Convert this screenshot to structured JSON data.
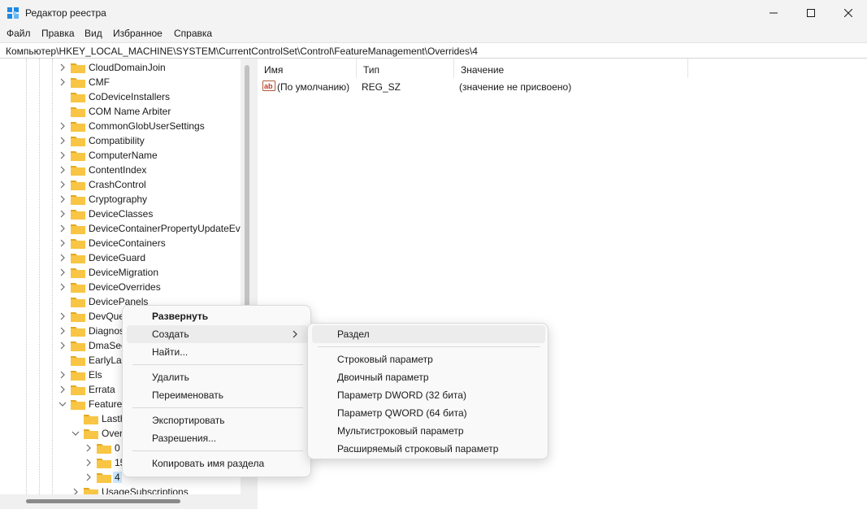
{
  "window": {
    "title": "Редактор реестра",
    "icon": "regedit-icon"
  },
  "menubar": {
    "items": [
      "Файл",
      "Правка",
      "Вид",
      "Избранное",
      "Справка"
    ]
  },
  "address": {
    "path": "Компьютер\\HKEY_LOCAL_MACHINE\\SYSTEM\\CurrentControlSet\\Control\\FeatureManagement\\Overrides\\4"
  },
  "tree": {
    "items": [
      {
        "label": "CloudDomainJoin"
      },
      {
        "label": "CMF"
      },
      {
        "label": "CoDeviceInstallers"
      },
      {
        "label": "COM Name Arbiter"
      },
      {
        "label": "CommonGlobUserSettings"
      },
      {
        "label": "Compatibility"
      },
      {
        "label": "ComputerName"
      },
      {
        "label": "ContentIndex"
      },
      {
        "label": "CrashControl"
      },
      {
        "label": "Cryptography"
      },
      {
        "label": "DeviceClasses"
      },
      {
        "label": "DeviceContainerPropertyUpdateEvents"
      },
      {
        "label": "DeviceContainers"
      },
      {
        "label": "DeviceGuard"
      },
      {
        "label": "DeviceMigration"
      },
      {
        "label": "DeviceOverrides"
      },
      {
        "label": "DevicePanels"
      },
      {
        "label": "DevQue"
      },
      {
        "label": "Diagnos"
      },
      {
        "label": "DmaSec"
      },
      {
        "label": "EarlyLau"
      },
      {
        "label": "Els"
      },
      {
        "label": "Errata"
      },
      {
        "label": "Feature"
      },
      {
        "label": "LastH"
      },
      {
        "label": "Over"
      },
      {
        "label": "0"
      },
      {
        "label": "15"
      },
      {
        "label": "4"
      },
      {
        "label": "UsageSubscriptions"
      }
    ]
  },
  "values_pane": {
    "columns": [
      "Имя",
      "Тип",
      "Значение"
    ],
    "rows": [
      {
        "name": "(По умолчанию)",
        "type": "REG_SZ",
        "data": "(значение не присвоено)"
      }
    ]
  },
  "context_menu": {
    "items": [
      "Развернуть",
      "Создать",
      "Найти...",
      "Удалить",
      "Переименовать",
      "Экспортировать",
      "Разрешения...",
      "Копировать имя раздела"
    ]
  },
  "submenu": {
    "items": [
      "Раздел",
      "Строковый параметр",
      "Двоичный параметр",
      "Параметр DWORD (32 бита)",
      "Параметр QWORD (64 бита)",
      "Мультистроковый параметр",
      "Расширяемый строковый параметр"
    ]
  },
  "colors": {
    "folder": "#f8c544",
    "folder_dark": "#e1a91f",
    "selection": "#cce8ff",
    "menu_hover": "#ececec"
  }
}
